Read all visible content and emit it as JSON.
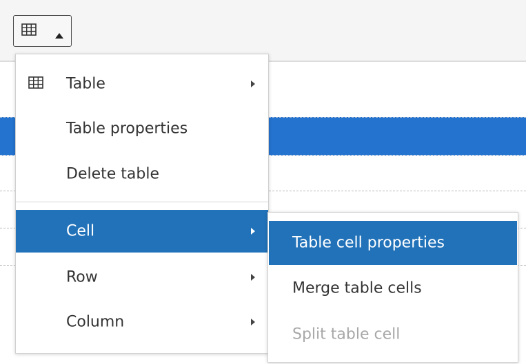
{
  "toolbar": {
    "table_button": {
      "icon": "table-grid-icon",
      "caret": "caret-up-icon"
    }
  },
  "menu": {
    "items": [
      {
        "label": "Table",
        "icon": "table-grid-icon",
        "has_submenu": true,
        "active": false
      },
      {
        "label": "Table properties",
        "has_submenu": false,
        "active": false
      },
      {
        "label": "Delete table",
        "has_submenu": false,
        "active": false
      },
      {
        "label": "Cell",
        "has_submenu": true,
        "active": true
      },
      {
        "label": "Row",
        "has_submenu": true,
        "active": false
      },
      {
        "label": "Column",
        "has_submenu": true,
        "active": false
      }
    ]
  },
  "submenu": {
    "items": [
      {
        "label": "Table cell properties",
        "active": true,
        "disabled": false
      },
      {
        "label": "Merge table cells",
        "active": false,
        "disabled": false
      },
      {
        "label": "Split table cell",
        "active": false,
        "disabled": true
      }
    ]
  },
  "colors": {
    "accent": "#2272b9",
    "selection": "#2473cf",
    "disabled_text": "#a8a8a8"
  }
}
